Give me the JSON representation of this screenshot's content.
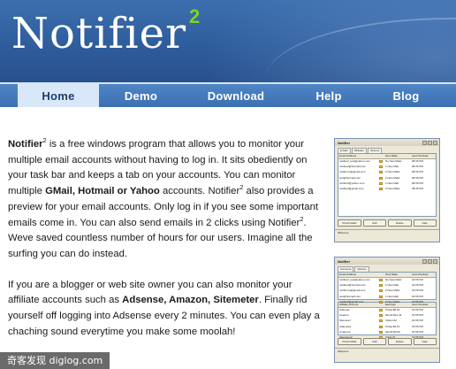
{
  "header": {
    "logo_text": "Notifier",
    "logo_sup": "2",
    "colors": {
      "header_blue": "#2e5d9c",
      "sup_green": "#7fd12a",
      "nav_blue": "#3b70b3",
      "nav_active_bg": "#d8e8f8"
    }
  },
  "nav": {
    "items": [
      {
        "label": "Home",
        "active": true
      },
      {
        "label": "Demo",
        "active": false
      },
      {
        "label": "Download",
        "active": false
      },
      {
        "label": "Help",
        "active": false
      },
      {
        "label": "Blog",
        "active": false
      }
    ]
  },
  "content": {
    "p1": {
      "s1_bold": "Notifier",
      "s1_sup": "2",
      "s2": " is a free windows program that allows you to monitor your multiple email accounts without having to log in. It sits obediently on your task bar and keeps a tab on your accounts. You can monitor multiple ",
      "s3_bold": "GMail, Hotmail or Yahoo",
      "s4": " accounts. Notifier",
      "s4_sup": "2",
      "s5": " also provides a preview for your email accounts. Only log in if you see some important emails come in. You can also send emails in 2 clicks using Notifier",
      "s5_sup": "2",
      "s6": ". Weve saved countless number of hours for our users. Imagine all the surfing you can do instead."
    },
    "p2": {
      "s1": "If you are a blogger or web site owner you can also monitor your affiliate accounts such as ",
      "s2_bold": "Adsense, Amazon, Sitemeter",
      "s3": ". Finally rid yourself off logging into Adsense every 2 minutes. You can even play a chaching sound everytime you make some moolah!"
    }
  },
  "screenshot1": {
    "title": "Notifier",
    "tabs": [
      "E-Mail",
      "Affiliates",
      "Options"
    ],
    "columns": [
      "Email Address",
      "",
      "New Mails",
      "Last Checked"
    ],
    "rows": [
      [
        "notifier2_test@yahoo.com",
        "No New Mails",
        "08:36 PM"
      ],
      [
        "notifier2@hotmail.com",
        "1 New Mail",
        "08:36 PM"
      ],
      [
        "notifier.tst@gmail.com",
        "2 New Mails",
        "08:36 PM"
      ],
      [
        "test@hotmail.com",
        "2 New Mails",
        "08:36 PM"
      ],
      [
        "notifier2@yahoo.com",
        "1 New Mail",
        "08:36 PM"
      ],
      [
        "notifier2@gmail.com",
        "2 New Mails",
        "08:36 PM"
      ]
    ],
    "buttons": [
      "Check Mails",
      "Add",
      "Delete",
      "Help"
    ],
    "status": "Welcome"
  },
  "screenshot2": {
    "title": "Notifier",
    "tabs": [
      "Accounts",
      "Options"
    ],
    "columns": [
      "Email Address",
      "",
      "New Mails",
      "Last Checked"
    ],
    "rows": [
      [
        "notifier2_test@yahoo.com",
        "No New Mails",
        "01:55 PM"
      ],
      [
        "notifier2@hotmail.com",
        "1 New Mail",
        "01:55 PM"
      ],
      [
        "notifier.tst@gmail.com",
        "2 New Mails",
        "01:55 PM"
      ],
      [
        "test@hotmail.com",
        "1 New Mail",
        "01:55 PM"
      ],
      [
        "notifier2@gmail.com",
        "2 New Mails",
        "01:55 PM"
      ]
    ],
    "columns2": [
      "Affiliate Account",
      "",
      "Earnings",
      "Last Checked"
    ],
    "rows2": [
      [
        "Adsense",
        "Today:$0.00",
        "01:55 PM"
      ],
      [
        "Amazon",
        "Month:$12.44",
        "01:55 PM"
      ],
      [
        "Sitemeter",
        "Visits:142",
        "01:55 PM"
      ],
      [
        "Adsense2",
        "Today:$3.10",
        "01:55 PM"
      ],
      [
        "Amazon2",
        "Month:$0.00",
        "01:55 PM"
      ],
      [
        "Sitemeter2",
        "Visits:37",
        "01:55 PM"
      ]
    ],
    "buttons": [
      "Check Mails",
      "Add",
      "Delete",
      "Help"
    ],
    "status": "Welcome"
  },
  "watermark": "奇客发现 diglog.com"
}
